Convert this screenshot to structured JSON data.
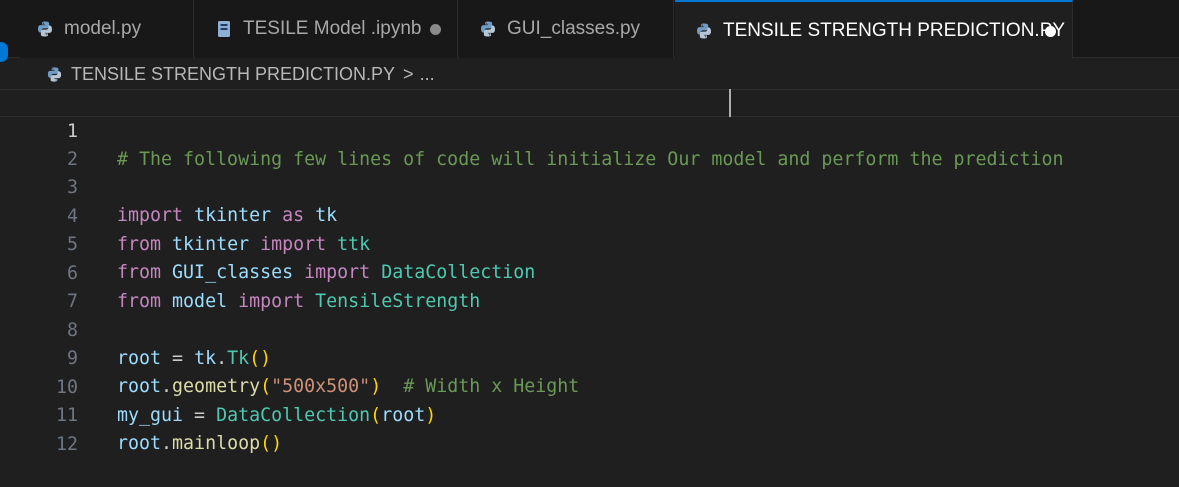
{
  "tabs": [
    {
      "label": "model.py",
      "icon": "python-icon",
      "modified": false,
      "active": false
    },
    {
      "label": "TESILE Model .ipynb",
      "icon": "notebook-icon",
      "modified": true,
      "active": false
    },
    {
      "label": "GUI_classes.py",
      "icon": "python-icon",
      "modified": false,
      "active": false
    },
    {
      "label": "TENSILE STRENGTH PREDICTION.PY",
      "icon": "python-icon",
      "modified": true,
      "active": true
    }
  ],
  "breadcrumb": {
    "file": "TENSILE STRENGTH PREDICTION.PY",
    "separator": ">",
    "more": "..."
  },
  "editor": {
    "current_line": 1,
    "line_numbers": [
      "1",
      "2",
      "3",
      "4",
      "5",
      "6",
      "7",
      "8",
      "9",
      "10",
      "11",
      "12"
    ],
    "lines": {
      "l1_comment": "# The following few lines of code will initialize Our model and perform the prediction",
      "l3_import": "import",
      "l3_mod": "tkinter",
      "l3_as": "as",
      "l3_alias": "tk",
      "l4_from": "from",
      "l4_mod": "tkinter",
      "l4_import": "import",
      "l4_name": "ttk",
      "l5_from": "from",
      "l5_mod": "GUI_classes",
      "l5_import": "import",
      "l5_name": "DataCollection",
      "l6_from": "from",
      "l6_mod": "model",
      "l6_import": "import",
      "l6_name": "TensileStrength",
      "l8_var": "root",
      "l8_eq": " = ",
      "l8_obj": "tk",
      "l8_dot": ".",
      "l8_cls": "Tk",
      "l8_parens": "()",
      "l9_var": "root",
      "l9_dot": ".",
      "l9_fn": "geometry",
      "l9_open": "(",
      "l9_str": "\"500x500\"",
      "l9_close": ")",
      "l9_comment": "  # Width x Height",
      "l10_var": "my_gui",
      "l10_eq": " = ",
      "l10_cls": "DataCollection",
      "l10_open": "(",
      "l10_arg": "root",
      "l10_close": ")",
      "l11_var": "root",
      "l11_dot": ".",
      "l11_fn": "mainloop",
      "l11_parens": "()"
    }
  },
  "colors": {
    "accent": "#0078d4",
    "comment": "#6a9955",
    "keyword": "#c586c0",
    "variable": "#9cdcfe",
    "class": "#4ec9b0",
    "function": "#dcdcaa",
    "string": "#ce9178"
  }
}
